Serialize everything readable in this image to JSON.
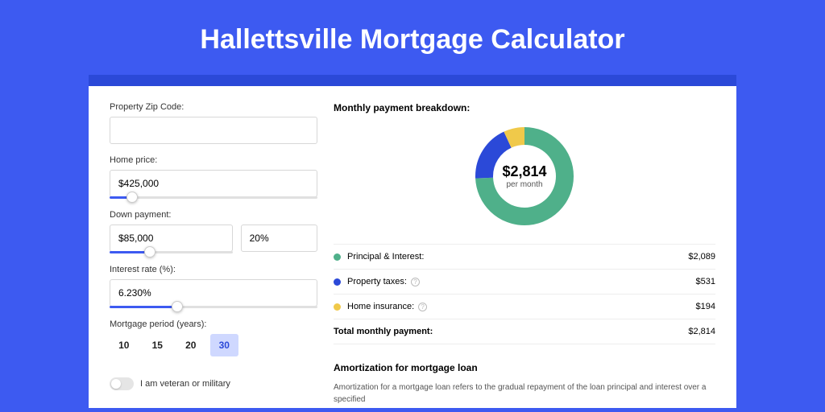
{
  "title": "Hallettsville Mortgage Calculator",
  "form": {
    "zip_label": "Property Zip Code:",
    "zip_value": "",
    "home_price_label": "Home price:",
    "home_price_value": "$425,000",
    "down_payment_label": "Down payment:",
    "down_payment_value": "$85,000",
    "down_payment_pct": "20%",
    "interest_label": "Interest rate (%):",
    "interest_value": "6.230%",
    "period_label": "Mortgage period (years):",
    "periods": [
      "10",
      "15",
      "20",
      "30"
    ],
    "period_active": "30",
    "veteran_label": "I am veteran or military"
  },
  "breakdown": {
    "title": "Monthly payment breakdown:",
    "center_amount": "$2,814",
    "center_sub": "per month",
    "rows": [
      {
        "color": "green",
        "label": "Principal & Interest:",
        "value": "$2,089",
        "help": false
      },
      {
        "color": "blue",
        "label": "Property taxes:",
        "value": "$531",
        "help": true
      },
      {
        "color": "yellow",
        "label": "Home insurance:",
        "value": "$194",
        "help": true
      }
    ],
    "total_label": "Total monthly payment:",
    "total_value": "$2,814"
  },
  "amort": {
    "title": "Amortization for mortgage loan",
    "text": "Amortization for a mortgage loan refers to the gradual repayment of the loan principal and interest over a specified"
  },
  "chart_data": {
    "type": "pie",
    "title": "Monthly payment breakdown",
    "series": [
      {
        "name": "Principal & Interest",
        "value": 2089,
        "color": "#4fb08a"
      },
      {
        "name": "Property taxes",
        "value": 531,
        "color": "#2b49d8"
      },
      {
        "name": "Home insurance",
        "value": 194,
        "color": "#f0c94a"
      }
    ],
    "total": 2814,
    "unit": "$ per month"
  }
}
